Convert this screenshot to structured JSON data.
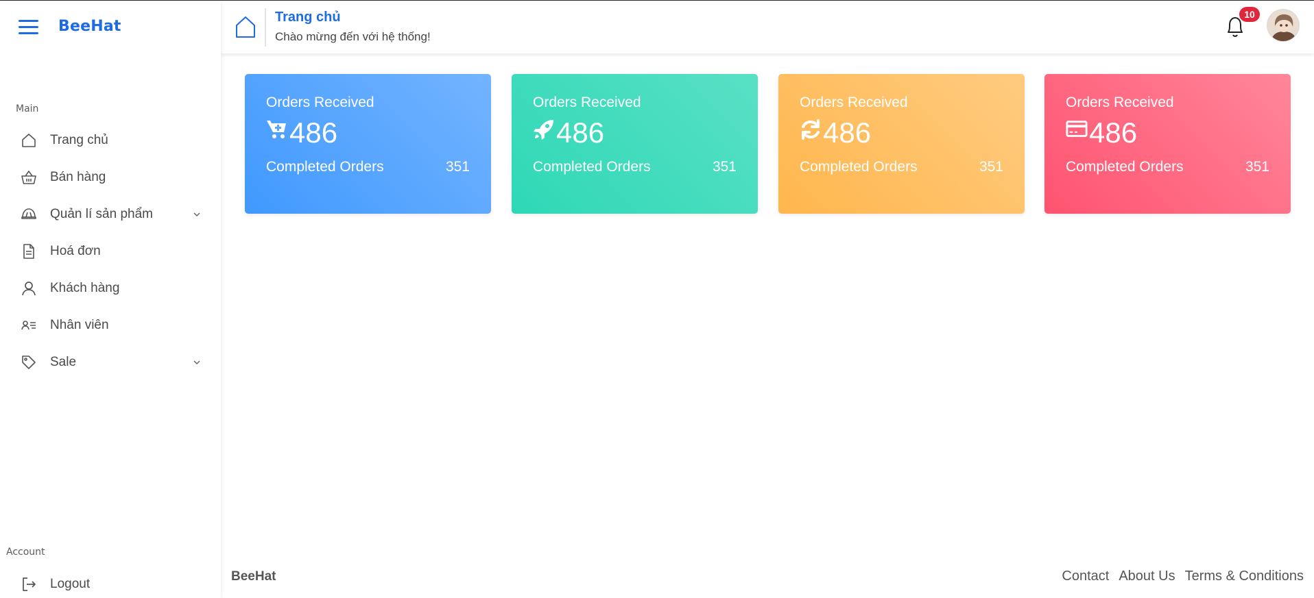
{
  "app": {
    "brand": "BeeHat"
  },
  "sidebar": {
    "sections": {
      "main": "Main",
      "account": "Account"
    },
    "items": [
      {
        "label": "Trang chủ",
        "icon": "home-icon"
      },
      {
        "label": "Bán hàng",
        "icon": "basket-icon"
      },
      {
        "label": "Quản lí sản phẩm",
        "icon": "helmet-icon",
        "has_submenu": true
      },
      {
        "label": "Hoá đơn",
        "icon": "document-icon"
      },
      {
        "label": "Khách hàng",
        "icon": "user-icon"
      },
      {
        "label": "Nhân viên",
        "icon": "user-list-icon"
      },
      {
        "label": "Sale",
        "icon": "tag-icon",
        "has_submenu": true
      }
    ],
    "logout": {
      "label": "Logout",
      "icon": "logout-icon"
    }
  },
  "header": {
    "title": "Trang chủ",
    "subtitle": "Chào mừng đến với hệ thống!",
    "notifications": {
      "count": "10"
    }
  },
  "cards": [
    {
      "title": "Orders Received",
      "value": "486",
      "footer_label": "Completed Orders",
      "footer_value": "351",
      "icon": "cart-plus-icon",
      "color": "#4099ff"
    },
    {
      "title": "Orders Received",
      "value": "486",
      "footer_label": "Completed Orders",
      "footer_value": "351",
      "icon": "rocket-icon",
      "color": "#2ed8b6"
    },
    {
      "title": "Orders Received",
      "value": "486",
      "footer_label": "Completed Orders",
      "footer_value": "351",
      "icon": "refresh-icon",
      "color": "#ffb64d"
    },
    {
      "title": "Orders Received",
      "value": "486",
      "footer_label": "Completed Orders",
      "footer_value": "351",
      "icon": "credit-card-icon",
      "color": "#ff5370"
    }
  ],
  "footer": {
    "brand": "BeeHat",
    "links": [
      "Contact",
      "About Us",
      "Terms & Conditions"
    ]
  },
  "colors": {
    "accent": "#1e6ce3",
    "badge": "#e0263a"
  }
}
